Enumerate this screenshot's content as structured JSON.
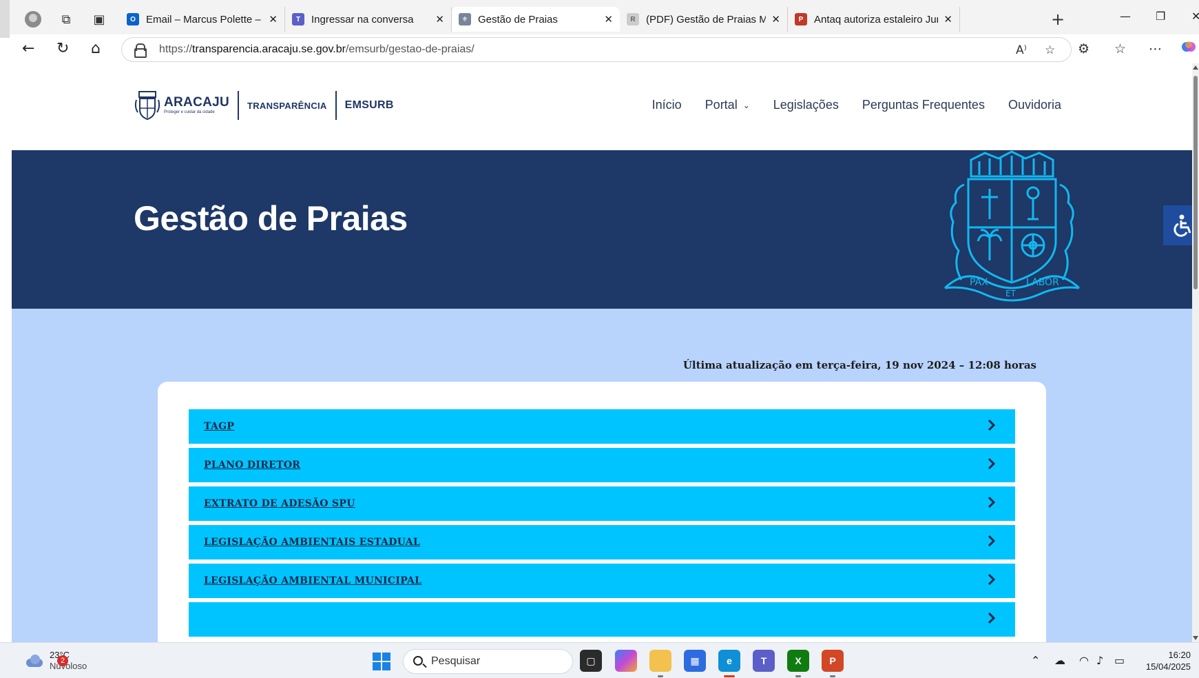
{
  "browser": {
    "tabs": [
      {
        "title": "Email – Marcus Polette – Outlook",
        "favicon": "outlook-icon",
        "color": "#0a64c8",
        "active": false
      },
      {
        "title": "Ingressar na conversa",
        "favicon": "teams-icon",
        "color": "#5b5fc7",
        "active": false
      },
      {
        "title": "Gestão de Praias",
        "favicon": "aracaju-crest-icon",
        "color": "#7a8599",
        "active": true
      },
      {
        "title": "(PDF) Gestão de Praias Marítimas",
        "favicon": "researchgate-icon",
        "color": "#cccccc",
        "active": false
      },
      {
        "title": "Antaq autoriza estaleiro Jurong A",
        "favicon": "news-icon",
        "color": "#c0392b",
        "active": false
      }
    ],
    "url": {
      "scheme": "https://",
      "host": "transparencia.aracaju.se.gov.br",
      "path": "/emsurb/gestao-de-praias/"
    }
  },
  "site": {
    "logo": {
      "name": "ARACAJU",
      "tagline": "Proteger e cuidar da cidade",
      "section1": "TRANSPARÊNCIA",
      "section2": "EMSURB"
    },
    "menu": [
      "Início",
      "Portal",
      "Legislações",
      "Perguntas Frequentes",
      "Ouvidoria"
    ],
    "hero": {
      "title": "Gestão de Praias",
      "motto": [
        "PAX",
        "ET",
        "LABOR"
      ]
    },
    "updated": "Última atualização em terça-feira, 19 nov 2024 – 12:08 horas",
    "accordion": [
      "TAGP",
      "PLANO DIRETOR",
      "EXTRATO DE ADESÃO SPU",
      "LEGISLAÇÃO AMBIENTAIS ESTADUAL",
      "LEGISLAÇÃO AMBIENTAL MUNICIPAL"
    ],
    "colors": {
      "hero_bg": "#1e3867",
      "content_bg": "#b8d3fc",
      "accordion_bg": "#00c4ff",
      "accent_crest": "#12b8f0"
    }
  },
  "taskbar": {
    "weather": {
      "temp": "23°C",
      "condition": "Nuvoloso",
      "badge": "2"
    },
    "search_placeholder": "Pesquisar",
    "time": "16:20",
    "date": "15/04/2025"
  }
}
